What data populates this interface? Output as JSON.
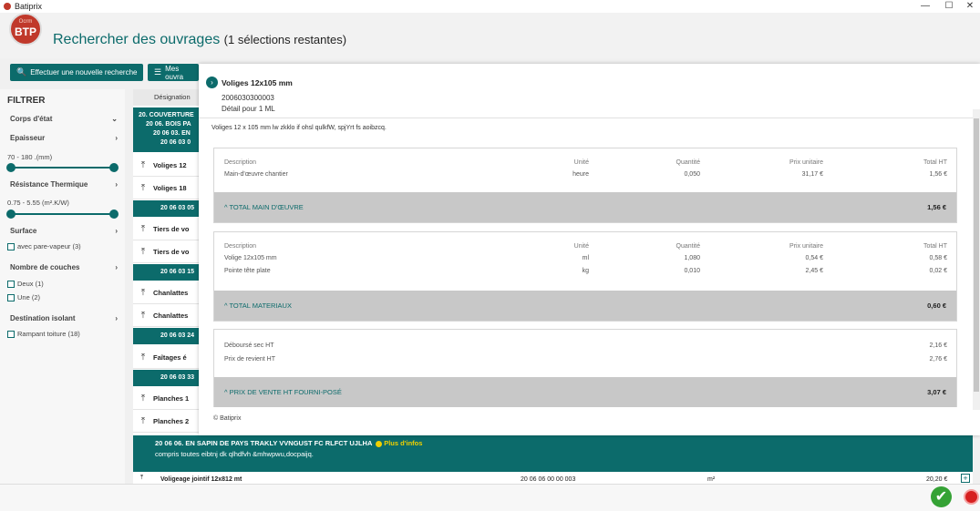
{
  "window": {
    "title": "Batiprix",
    "min": "—",
    "max": "☐",
    "close": "✕"
  },
  "logo": {
    "top": "Ocrm",
    "main": "BTP"
  },
  "header": {
    "title": "Rechercher des ouvrages",
    "subtitle": "(1 sélections restantes)"
  },
  "toolbar": {
    "new_search": "Effectuer une nouvelle recherche",
    "mine": "Mes ouvra"
  },
  "sidebar": {
    "title": "FILTRER",
    "corps": "Corps d'état",
    "epaisseur": "Epaisseur",
    "epaisseur_range": "70 - 180 .(mm)",
    "resistance": "Résistance Thermique",
    "resistance_range": "0.75 - 5.55  (m².K/W)",
    "surface": "Surface",
    "surface_opt": "avec pare-vapeur (3)",
    "couches": "Nombre de couches",
    "couches_opt1": "Deux (1)",
    "couches_opt2": "Une (2)",
    "destination": "Destination isolant",
    "destination_opt": "Rampant toiture (18)"
  },
  "list": {
    "col_designation": "Désignation",
    "group1": [
      "20. COUVERTURE",
      "20 06. BOIS PA",
      "20 06 03. EN",
      "20 06 03 0"
    ],
    "rows": [
      {
        "label": "Voliges 12"
      },
      {
        "label": "Voliges 18"
      },
      {
        "group": "20 06 03 05"
      },
      {
        "label": "Tiers de vo"
      },
      {
        "label": "Tiers de vo"
      },
      {
        "group": "20 06 03 15"
      },
      {
        "label": "Chanlattes"
      },
      {
        "label": "Chanlattes"
      },
      {
        "group": "20 06 03 24"
      },
      {
        "label": "Faîtages é"
      },
      {
        "group": "20 06 03 33"
      },
      {
        "label": "Planches 1"
      },
      {
        "label": "Planches 2"
      }
    ]
  },
  "bottom": {
    "title": "20 06 06. EN SAPIN DE PAYS TRAKLY VVNGUST FC RLFCT UJLHA",
    "info": "Plus d'infos",
    "desc": "compris toutes eibtnj dk qlhdfvh &mhwpwu,docpaijq.",
    "row_label": "Voligeage jointif 12x812 mt",
    "row_code": "20 06 06 00 00 003",
    "row_unit": "m²",
    "row_total": "20,20 €"
  },
  "modal": {
    "title": "Voliges 12x105 mm",
    "code": "2006030300003",
    "detail": "Détail pour 1 ML",
    "description": "Voliges 12 x 105 mm lw zkklo if ohsl qulkfW, spjYrt fs aoibzcq.",
    "columns": {
      "desc": "Description",
      "unit": "Unité",
      "qty": "Quantité",
      "price": "Prix unitaire",
      "total": "Total HT"
    },
    "labour": {
      "rows": [
        {
          "desc": "Main-d'œuvre chantier",
          "unit": "heure",
          "qty": "0,050",
          "price": "31,17 €",
          "total": "1,56 €"
        }
      ],
      "total_label": "TOTAL MAIN D'ŒUVRE",
      "total_value": "1,56 €"
    },
    "materials": {
      "rows": [
        {
          "desc": "Volige 12x105 mm",
          "unit": "ml",
          "qty": "1,080",
          "price": "0,54 €",
          "total": "0,58 €"
        },
        {
          "desc": "Pointe tête plate",
          "unit": "kg",
          "qty": "0,010",
          "price": "2,45 €",
          "total": "0,02 €"
        }
      ],
      "total_label": "TOTAL MATERIAUX",
      "total_value": "0,60 €"
    },
    "summary": {
      "debourse_label": "Déboursé sec HT",
      "debourse_value": "2,16 €",
      "revient_label": "Prix de revient HT",
      "revient_value": "2,76 €",
      "total_label": "PRIX DE VENTE HT FOURNI-POSÉ",
      "total_value": "3,07 €"
    },
    "copyright": "© Batiprix"
  },
  "colors": {
    "accent": "#0c6b6b",
    "ok": "#35a235",
    "cancel": "#d62020"
  }
}
